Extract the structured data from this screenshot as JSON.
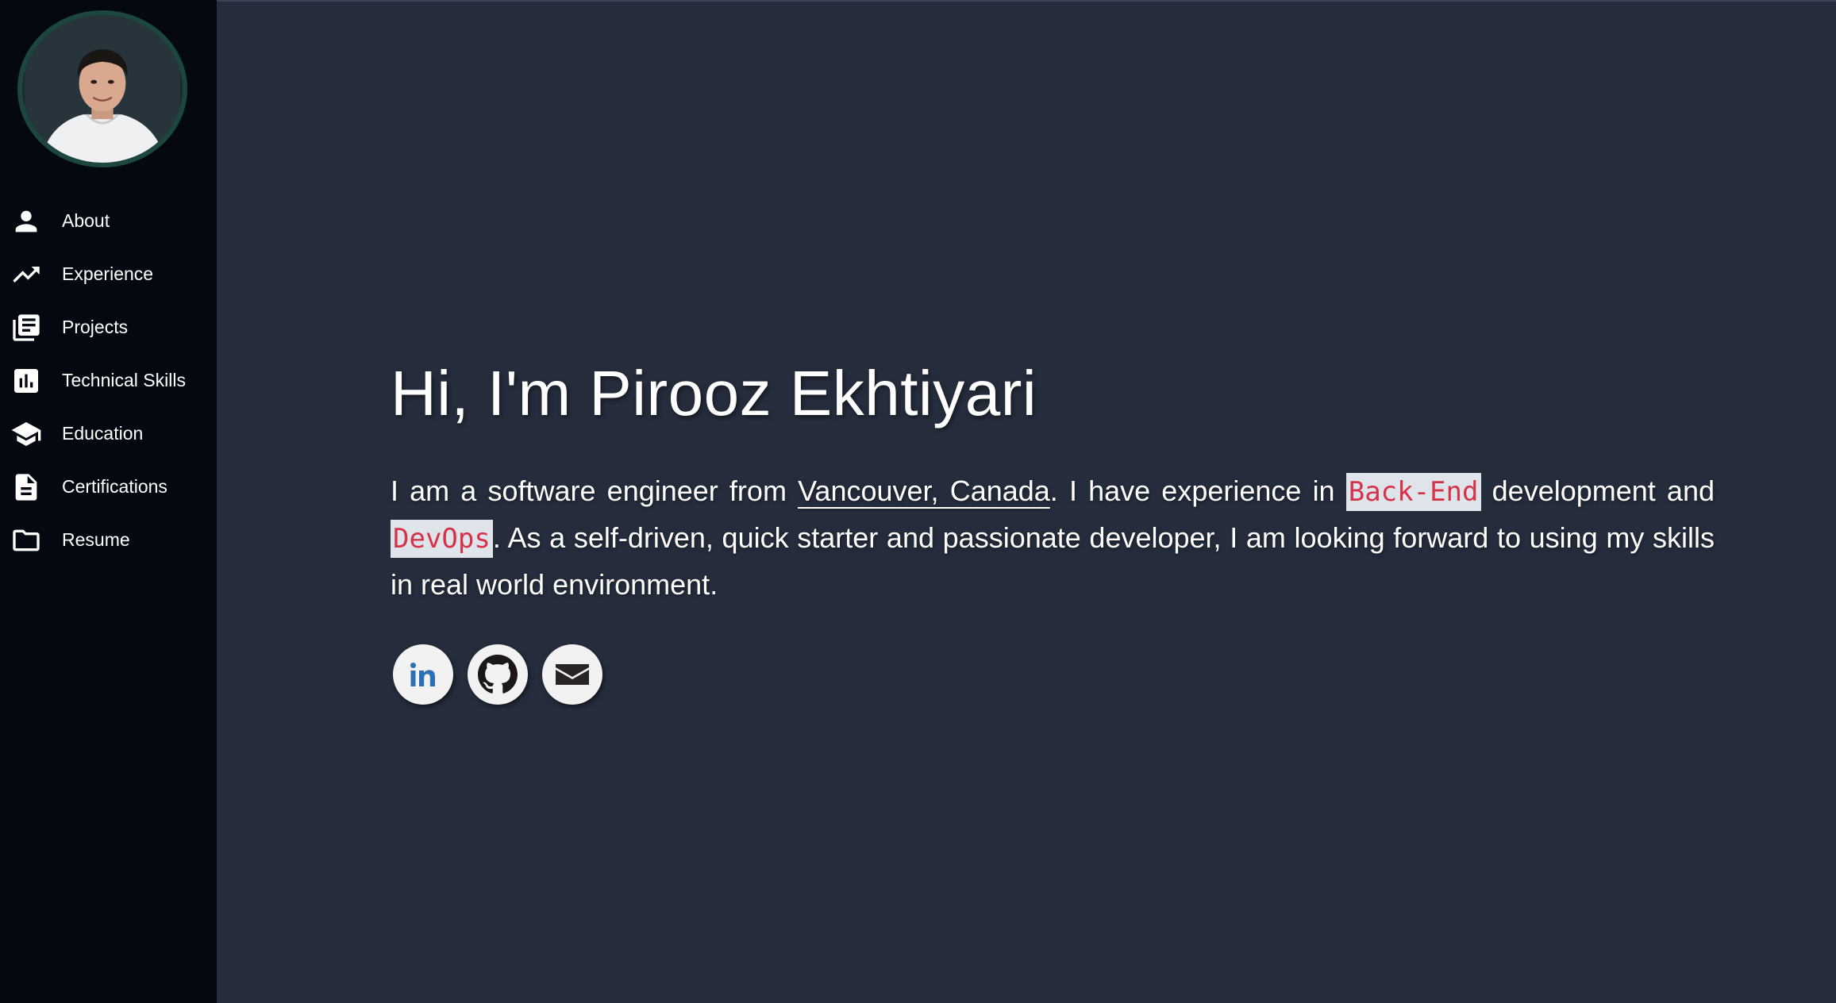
{
  "sidebar": {
    "avatar_icon": "profile-photo",
    "items": [
      {
        "label": "About",
        "icon": "person-icon"
      },
      {
        "label": "Experience",
        "icon": "trending-up-icon"
      },
      {
        "label": "Projects",
        "icon": "library-books-icon"
      },
      {
        "label": "Technical Skills",
        "icon": "bar-chart-icon"
      },
      {
        "label": "Education",
        "icon": "school-icon"
      },
      {
        "label": "Certifications",
        "icon": "document-icon"
      },
      {
        "label": "Resume",
        "icon": "folder-icon"
      }
    ]
  },
  "main": {
    "heading": "Hi, I'm Pirooz Ekhtiyari",
    "intro": {
      "part1": "I am a software engineer from ",
      "location_link": "Vancouver, Canada",
      "part2": ". I have experience in ",
      "skill1": "Back-End",
      "part3": " development and ",
      "skill2": "DevOps",
      "part4": ". As a self-driven, quick starter and passionate developer, I am looking forward to using my skills in real world environment."
    },
    "socials": [
      {
        "name": "linkedin-icon",
        "text": "in"
      },
      {
        "name": "github-icon"
      },
      {
        "name": "email-icon"
      }
    ]
  },
  "colors": {
    "sidebar_bg": "#040911",
    "main_bg": "#252d3d",
    "code_text": "#d6334a",
    "code_bg": "#dfe3ea",
    "linkedin_blue": "#2d6fb5"
  }
}
